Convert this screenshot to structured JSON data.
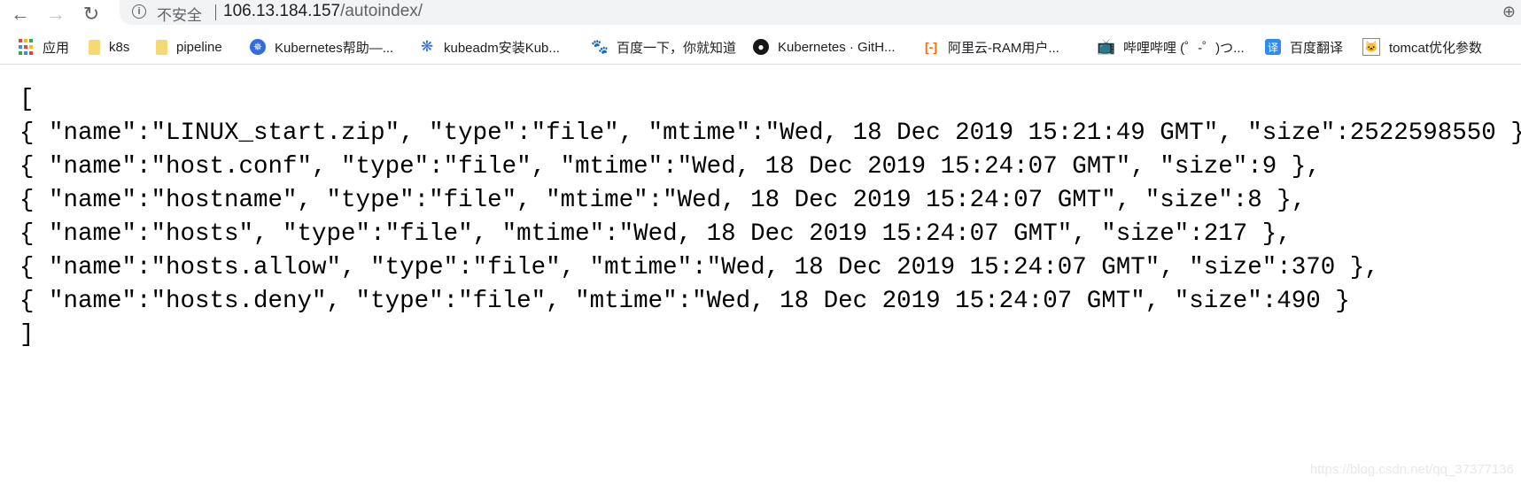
{
  "browser": {
    "security_label": "不安全",
    "url_host": "106.13.184.157",
    "url_path": "/autoindex/"
  },
  "bookmarks": [
    {
      "label": "应用",
      "icon": "apps-grid-icon"
    },
    {
      "label": "k8s",
      "icon": "folder-icon"
    },
    {
      "label": "pipeline",
      "icon": "folder-icon"
    },
    {
      "label": "Kubernetes帮助—...",
      "icon": "kubernetes-icon"
    },
    {
      "label": "kubeadm安装Kub...",
      "icon": "helm-wheel-icon"
    },
    {
      "label": "百度一下，你就知道",
      "icon": "baidu-paw-icon"
    },
    {
      "label": "Kubernetes · GitH...",
      "icon": "github-icon"
    },
    {
      "label": "阿里云-RAM用户...",
      "icon": "aliyun-icon"
    },
    {
      "label": "哔哩哔哩 (゜-゜)つ...",
      "icon": "bilibili-icon"
    },
    {
      "label": "百度翻译",
      "icon": "baidu-translate-icon"
    },
    {
      "label": "tomcat优化参数",
      "icon": "tomcat-icon"
    }
  ],
  "json_lines": [
    "[",
    "{ \"name\":\"LINUX_start.zip\", \"type\":\"file\", \"mtime\":\"Wed, 18 Dec 2019 15:21:49 GMT\", \"size\":2522598550 },",
    "{ \"name\":\"host.conf\", \"type\":\"file\", \"mtime\":\"Wed, 18 Dec 2019 15:24:07 GMT\", \"size\":9 },",
    "{ \"name\":\"hostname\", \"type\":\"file\", \"mtime\":\"Wed, 18 Dec 2019 15:24:07 GMT\", \"size\":8 },",
    "{ \"name\":\"hosts\", \"type\":\"file\", \"mtime\":\"Wed, 18 Dec 2019 15:24:07 GMT\", \"size\":217 },",
    "{ \"name\":\"hosts.allow\", \"type\":\"file\", \"mtime\":\"Wed, 18 Dec 2019 15:24:07 GMT\", \"size\":370 },",
    "{ \"name\":\"hosts.deny\", \"type\":\"file\", \"mtime\":\"Wed, 18 Dec 2019 15:24:07 GMT\", \"size\":490 }",
    "]"
  ],
  "watermark": "https://blog.csdn.net/qq_37377136"
}
